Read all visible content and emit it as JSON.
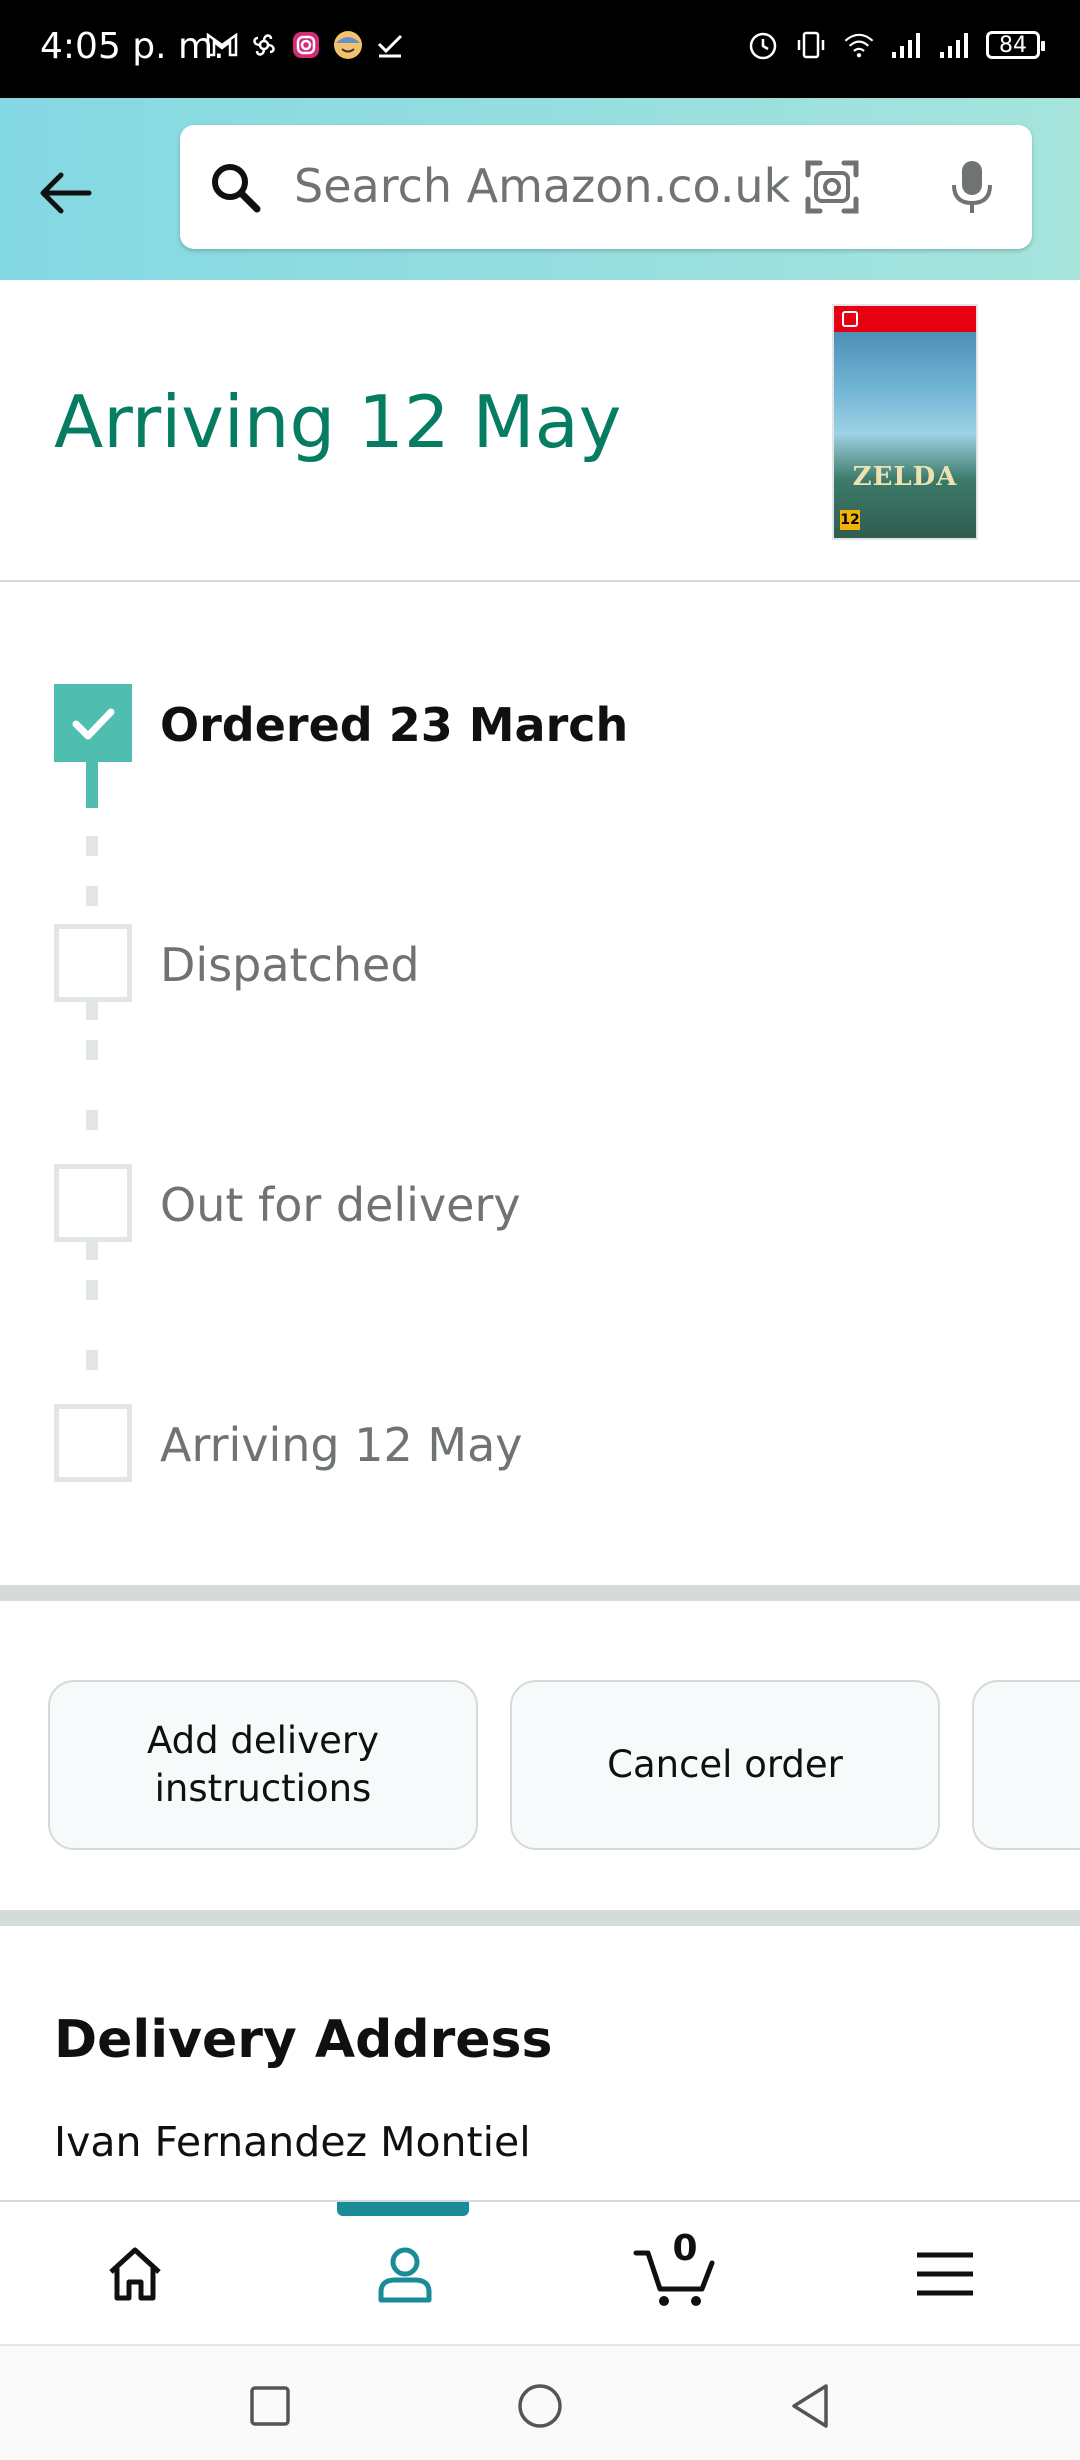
{
  "status_bar": {
    "time": "4:05 p. m.",
    "battery": "84",
    "left_icons": [
      "gmail-icon",
      "pinwheel-icon",
      "instagram-icon",
      "emoji-icon",
      "check-icon"
    ],
    "right_icons": [
      "alarm-icon",
      "vibrate-icon",
      "wifi-icon",
      "signal-icon",
      "signal-icon"
    ]
  },
  "header": {
    "search_placeholder": "Search Amazon.co.uk",
    "gradient_start": "#84d8e3",
    "gradient_end": "#a6e4dc"
  },
  "order": {
    "arriving_title": "Arriving 12 May",
    "product_image_text": "ZELDA",
    "product_rating": "12",
    "accent_color": "#067d62"
  },
  "tracker": {
    "steps": [
      {
        "label": "Ordered 23 March",
        "done": true
      },
      {
        "label": "Dispatched",
        "done": false
      },
      {
        "label": "Out for delivery",
        "done": false
      },
      {
        "label": "Arriving 12 May",
        "done": false
      }
    ],
    "done_color": "#4fbdb0"
  },
  "actions": {
    "buttons": [
      "Add delivery instructions",
      "Cancel order",
      ""
    ]
  },
  "address": {
    "title": "Delivery Address",
    "name": "Ivan Fernandez Montiel"
  },
  "bottom_nav": {
    "items": [
      "home-icon",
      "account-icon",
      "cart-icon",
      "menu-icon"
    ],
    "cart_count": "0",
    "active_item": "account-icon"
  }
}
